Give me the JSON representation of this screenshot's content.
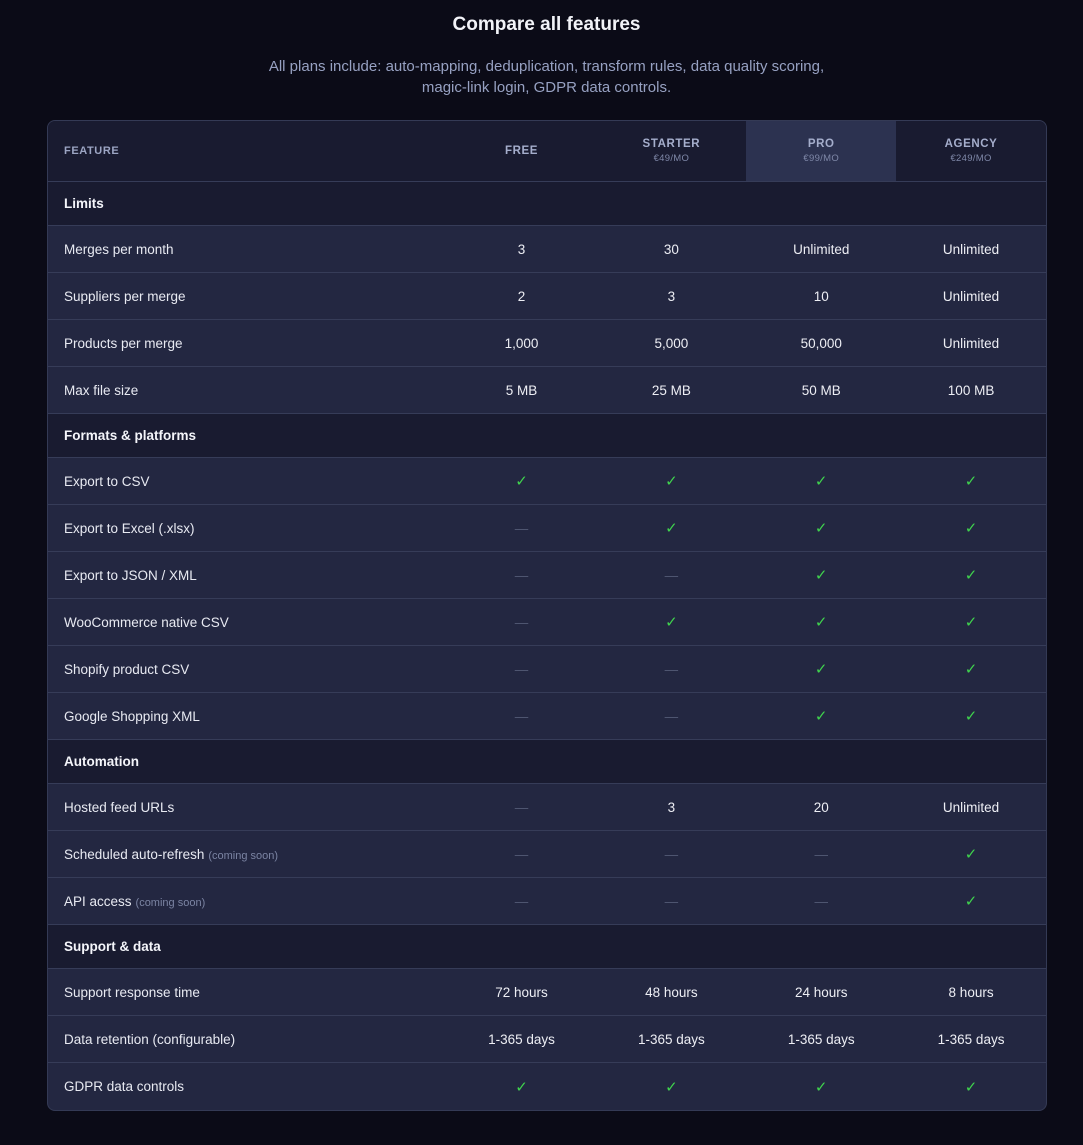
{
  "heading": "Compare all features",
  "subtitle": "All plans include: auto-mapping, deduplication, transform rules, data quality scoring, magic-link login, GDPR data controls.",
  "colors": {
    "check": "#3fd24d",
    "dash": "#525974",
    "highlight": "#2c3250"
  },
  "header": {
    "feature": "FEATURE",
    "plans": [
      {
        "name": "FREE",
        "price": ""
      },
      {
        "name": "STARTER",
        "price": "€49/MO"
      },
      {
        "name": "PRO",
        "price": "€99/MO",
        "highlight": true
      },
      {
        "name": "AGENCY",
        "price": "€249/MO"
      }
    ]
  },
  "rows": [
    {
      "type": "section",
      "label": "Limits"
    },
    {
      "label": "Merges per month",
      "values": [
        "3",
        "30",
        "Unlimited",
        "Unlimited"
      ]
    },
    {
      "label": "Suppliers per merge",
      "values": [
        "2",
        "3",
        "10",
        "Unlimited"
      ]
    },
    {
      "label": "Products per merge",
      "values": [
        "1,000",
        "5,000",
        "50,000",
        "Unlimited"
      ]
    },
    {
      "label": "Max file size",
      "values": [
        "5 MB",
        "25 MB",
        "50 MB",
        "100 MB"
      ]
    },
    {
      "type": "section",
      "label": "Formats & platforms"
    },
    {
      "label": "Export to CSV",
      "values": [
        "✓",
        "✓",
        "✓",
        "✓"
      ]
    },
    {
      "label": "Export to Excel (.xlsx)",
      "values": [
        "—",
        "✓",
        "✓",
        "✓"
      ]
    },
    {
      "label": "Export to JSON / XML",
      "values": [
        "—",
        "—",
        "✓",
        "✓"
      ]
    },
    {
      "label": "WooCommerce native CSV",
      "values": [
        "—",
        "✓",
        "✓",
        "✓"
      ]
    },
    {
      "label": "Shopify product CSV",
      "values": [
        "—",
        "—",
        "✓",
        "✓"
      ]
    },
    {
      "label": "Google Shopping XML",
      "values": [
        "—",
        "—",
        "✓",
        "✓"
      ]
    },
    {
      "type": "section",
      "label": "Automation"
    },
    {
      "label": "Hosted feed URLs",
      "values": [
        "—",
        "3",
        "20",
        "Unlimited"
      ]
    },
    {
      "label": "Scheduled auto-refresh",
      "note": "(coming soon)",
      "values": [
        "—",
        "—",
        "—",
        "✓"
      ]
    },
    {
      "label": "API access",
      "note": "(coming soon)",
      "values": [
        "—",
        "—",
        "—",
        "✓"
      ]
    },
    {
      "type": "section",
      "label": "Support & data"
    },
    {
      "label": "Support response time",
      "values": [
        "72 hours",
        "48 hours",
        "24 hours",
        "8 hours"
      ]
    },
    {
      "label": "Data retention (configurable)",
      "values": [
        "1-365 days",
        "1-365 days",
        "1-365 days",
        "1-365 days"
      ]
    },
    {
      "label": "GDPR data controls",
      "values": [
        "✓",
        "✓",
        "✓",
        "✓"
      ]
    }
  ]
}
